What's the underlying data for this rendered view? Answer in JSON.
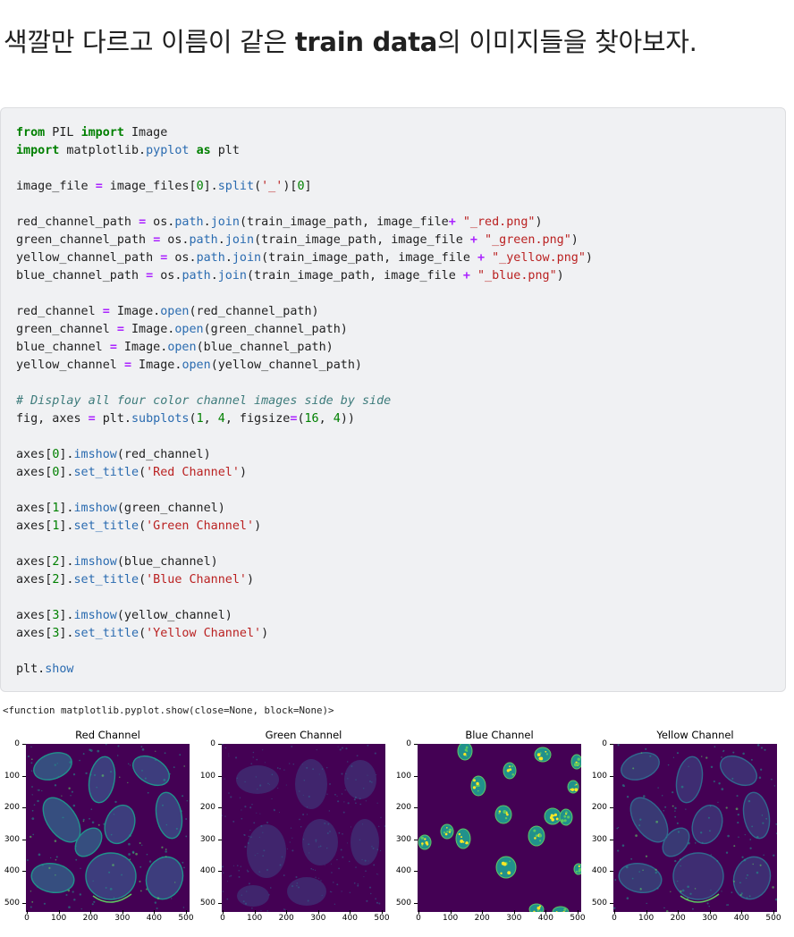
{
  "heading": {
    "part1": "색깔만 다르고 이름이 같은 ",
    "bold": "train data",
    "part2": "의 이미지들을 찾아보자."
  },
  "code_lines": [
    [
      [
        "kw",
        "from"
      ],
      [
        "t",
        " PIL "
      ],
      [
        "kw",
        "import"
      ],
      [
        "t",
        " Image"
      ]
    ],
    [
      [
        "kw",
        "import"
      ],
      [
        "t",
        " matplotlib."
      ],
      [
        "fn",
        "pyplot"
      ],
      [
        "t",
        " "
      ],
      [
        "kw",
        "as"
      ],
      [
        "t",
        " plt"
      ]
    ],
    [],
    [
      [
        "t",
        "image_file "
      ],
      [
        "op",
        "="
      ],
      [
        "t",
        " image_files["
      ],
      [
        "nm",
        "0"
      ],
      [
        "t",
        "]."
      ],
      [
        "fn",
        "split"
      ],
      [
        "t",
        "("
      ],
      [
        "st",
        "'_'"
      ],
      [
        "t",
        ")["
      ],
      [
        "nm",
        "0"
      ],
      [
        "t",
        "]"
      ]
    ],
    [],
    [
      [
        "t",
        "red_channel_path "
      ],
      [
        "op",
        "="
      ],
      [
        "t",
        " os."
      ],
      [
        "fn",
        "path"
      ],
      [
        "t",
        "."
      ],
      [
        "fn",
        "join"
      ],
      [
        "t",
        "(train_image_path, image_file"
      ],
      [
        "op",
        "+"
      ],
      [
        "t",
        " "
      ],
      [
        "st",
        "\"_red.png\""
      ],
      [
        "t",
        ")"
      ]
    ],
    [
      [
        "t",
        "green_channel_path "
      ],
      [
        "op",
        "="
      ],
      [
        "t",
        " os."
      ],
      [
        "fn",
        "path"
      ],
      [
        "t",
        "."
      ],
      [
        "fn",
        "join"
      ],
      [
        "t",
        "(train_image_path, image_file "
      ],
      [
        "op",
        "+"
      ],
      [
        "t",
        " "
      ],
      [
        "st",
        "\"_green.png\""
      ],
      [
        "t",
        ")"
      ]
    ],
    [
      [
        "t",
        "yellow_channel_path "
      ],
      [
        "op",
        "="
      ],
      [
        "t",
        " os."
      ],
      [
        "fn",
        "path"
      ],
      [
        "t",
        "."
      ],
      [
        "fn",
        "join"
      ],
      [
        "t",
        "(train_image_path, image_file "
      ],
      [
        "op",
        "+"
      ],
      [
        "t",
        " "
      ],
      [
        "st",
        "\"_yellow.png\""
      ],
      [
        "t",
        ")"
      ]
    ],
    [
      [
        "t",
        "blue_channel_path "
      ],
      [
        "op",
        "="
      ],
      [
        "t",
        " os."
      ],
      [
        "fn",
        "path"
      ],
      [
        "t",
        "."
      ],
      [
        "fn",
        "join"
      ],
      [
        "t",
        "(train_image_path, image_file "
      ],
      [
        "op",
        "+"
      ],
      [
        "t",
        " "
      ],
      [
        "st",
        "\"_blue.png\""
      ],
      [
        "t",
        ")"
      ]
    ],
    [],
    [
      [
        "t",
        "red_channel "
      ],
      [
        "op",
        "="
      ],
      [
        "t",
        " Image."
      ],
      [
        "fn",
        "open"
      ],
      [
        "t",
        "(red_channel_path)"
      ]
    ],
    [
      [
        "t",
        "green_channel "
      ],
      [
        "op",
        "="
      ],
      [
        "t",
        " Image."
      ],
      [
        "fn",
        "open"
      ],
      [
        "t",
        "(green_channel_path)"
      ]
    ],
    [
      [
        "t",
        "blue_channel "
      ],
      [
        "op",
        "="
      ],
      [
        "t",
        " Image."
      ],
      [
        "fn",
        "open"
      ],
      [
        "t",
        "(blue_channel_path)"
      ]
    ],
    [
      [
        "t",
        "yellow_channel "
      ],
      [
        "op",
        "="
      ],
      [
        "t",
        " Image."
      ],
      [
        "fn",
        "open"
      ],
      [
        "t",
        "(yellow_channel_path)"
      ]
    ],
    [],
    [
      [
        "cm",
        "# Display all four color channel images side by side"
      ]
    ],
    [
      [
        "t",
        "fig, axes "
      ],
      [
        "op",
        "="
      ],
      [
        "t",
        " plt."
      ],
      [
        "fn",
        "subplots"
      ],
      [
        "t",
        "("
      ],
      [
        "nm",
        "1"
      ],
      [
        "t",
        ", "
      ],
      [
        "nm",
        "4"
      ],
      [
        "t",
        ", figsize"
      ],
      [
        "op",
        "="
      ],
      [
        "t",
        "("
      ],
      [
        "nm",
        "16"
      ],
      [
        "t",
        ", "
      ],
      [
        "nm",
        "4"
      ],
      [
        "t",
        "))"
      ]
    ],
    [],
    [
      [
        "t",
        "axes["
      ],
      [
        "nm",
        "0"
      ],
      [
        "t",
        "]."
      ],
      [
        "fn",
        "imshow"
      ],
      [
        "t",
        "(red_channel)"
      ]
    ],
    [
      [
        "t",
        "axes["
      ],
      [
        "nm",
        "0"
      ],
      [
        "t",
        "]."
      ],
      [
        "fn",
        "set_title"
      ],
      [
        "t",
        "("
      ],
      [
        "st",
        "'Red Channel'"
      ],
      [
        "t",
        ")"
      ]
    ],
    [],
    [
      [
        "t",
        "axes["
      ],
      [
        "nm",
        "1"
      ],
      [
        "t",
        "]."
      ],
      [
        "fn",
        "imshow"
      ],
      [
        "t",
        "(green_channel)"
      ]
    ],
    [
      [
        "t",
        "axes["
      ],
      [
        "nm",
        "1"
      ],
      [
        "t",
        "]."
      ],
      [
        "fn",
        "set_title"
      ],
      [
        "t",
        "("
      ],
      [
        "st",
        "'Green Channel'"
      ],
      [
        "t",
        ")"
      ]
    ],
    [],
    [
      [
        "t",
        "axes["
      ],
      [
        "nm",
        "2"
      ],
      [
        "t",
        "]."
      ],
      [
        "fn",
        "imshow"
      ],
      [
        "t",
        "(blue_channel)"
      ]
    ],
    [
      [
        "t",
        "axes["
      ],
      [
        "nm",
        "2"
      ],
      [
        "t",
        "]."
      ],
      [
        "fn",
        "set_title"
      ],
      [
        "t",
        "("
      ],
      [
        "st",
        "'Blue Channel'"
      ],
      [
        "t",
        ")"
      ]
    ],
    [],
    [
      [
        "t",
        "axes["
      ],
      [
        "nm",
        "3"
      ],
      [
        "t",
        "]."
      ],
      [
        "fn",
        "imshow"
      ],
      [
        "t",
        "(yellow_channel)"
      ]
    ],
    [
      [
        "t",
        "axes["
      ],
      [
        "nm",
        "3"
      ],
      [
        "t",
        "]."
      ],
      [
        "fn",
        "set_title"
      ],
      [
        "t",
        "("
      ],
      [
        "st",
        "'Yellow Channel'"
      ],
      [
        "t",
        ")"
      ]
    ],
    [],
    [
      [
        "t",
        "plt."
      ],
      [
        "fn",
        "show"
      ]
    ]
  ],
  "output_text": "<function matplotlib.pyplot.show(close=None, block=None)>",
  "panels": [
    {
      "title": "Red Channel",
      "style": "cytoplasm"
    },
    {
      "title": "Green Channel",
      "style": "faint"
    },
    {
      "title": "Blue Channel",
      "style": "nuclei"
    },
    {
      "title": "Yellow Channel",
      "style": "cytoplasm"
    }
  ],
  "axis_ticks": {
    "y": [
      "0",
      "100",
      "200",
      "300",
      "400",
      "500"
    ],
    "x": [
      "0",
      "100",
      "200",
      "300",
      "400",
      "500"
    ]
  },
  "colors": {
    "viridis_dark": "#440154",
    "viridis_mid": "#31688e",
    "viridis_teal": "#21918c",
    "viridis_green": "#5ec962",
    "viridis_yellow": "#fde725"
  }
}
